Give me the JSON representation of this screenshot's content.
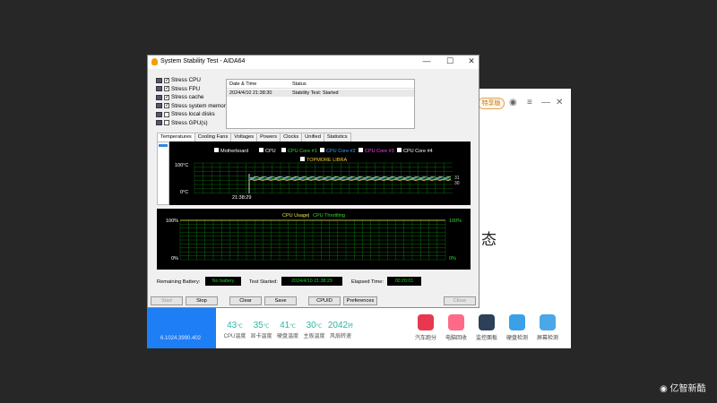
{
  "window": {
    "title": "System Stability Test - AIDA64"
  },
  "stress_options": [
    {
      "label": "Stress CPU",
      "checked": true
    },
    {
      "label": "Stress FPU",
      "checked": true
    },
    {
      "label": "Stress cache",
      "checked": true
    },
    {
      "label": "Stress system memory",
      "checked": true
    },
    {
      "label": "Stress local disks",
      "checked": false
    },
    {
      "label": "Stress GPU(s)",
      "checked": false
    }
  ],
  "log": {
    "headers": [
      "Date & Time",
      "Status"
    ],
    "rows": [
      {
        "datetime": "2024/4/10 21:38:30",
        "status": "Stability Test: Started"
      }
    ]
  },
  "tabs": [
    "Temperatures",
    "Cooling Fans",
    "Voltages",
    "Powers",
    "Clocks",
    "Unified",
    "Statistics"
  ],
  "active_tab": "Temperatures",
  "temp_chart": {
    "legend": [
      "Motherboard",
      "CPU",
      "CPU Core #1",
      "CPU Core #2",
      "CPU Core #3",
      "CPU Core #4",
      "TOPMORE LIBRA"
    ],
    "legend_colors": [
      "#ffffff",
      "#ffffff",
      "#33dd33",
      "#33aaff",
      "#ff44ff",
      "#ffffff",
      "#ffcc33"
    ],
    "y_top": "100°C",
    "y_bottom": "0°C",
    "x_label": "21:38:29",
    "right_values": [
      "31",
      "30"
    ]
  },
  "cpu_chart": {
    "title1": "CPU Usage",
    "sep": "|",
    "title2": "CPU Throttling",
    "y_top_left": "100%",
    "y_bottom_left": "0%",
    "y_top_right": "100%",
    "y_bottom_right": "0%"
  },
  "status": {
    "battery_label": "Remaining Battery:",
    "battery_value": "No battery",
    "started_label": "Test Started:",
    "started_value": "2024/4/10 21:38:29",
    "elapsed_label": "Elapsed Time:",
    "elapsed_value": "00:20:01"
  },
  "buttons": {
    "start": "Start",
    "stop": "Stop",
    "clear": "Clear",
    "save": "Save",
    "cpuid": "CPUID",
    "preferences": "Preferences",
    "close": "Close"
  },
  "bg_app": {
    "vip": "特享版",
    "big_char": "态",
    "version": "6.1024.3990.402",
    "stats": [
      {
        "value": "43",
        "unit": "℃",
        "label": "CPU温度"
      },
      {
        "value": "35",
        "unit": "℃",
        "label": "显卡温度"
      },
      {
        "value": "41",
        "unit": "℃",
        "label": "硬盘温度"
      },
      {
        "value": "30",
        "unit": "℃",
        "label": "主板温度"
      },
      {
        "value": "2042",
        "unit": "转",
        "label": "风扇转速"
      }
    ],
    "tools": [
      {
        "label": "汽车跑分",
        "color": "#e8384f"
      },
      {
        "label": "电脑回收",
        "color": "#ff6a88"
      },
      {
        "label": "监控面板",
        "color": "#2d4059"
      },
      {
        "label": "硬盘检测",
        "color": "#3aa0e8"
      },
      {
        "label": "屏幕检测",
        "color": "#4aa8e8"
      }
    ]
  },
  "watermark": "亿智新酷"
}
